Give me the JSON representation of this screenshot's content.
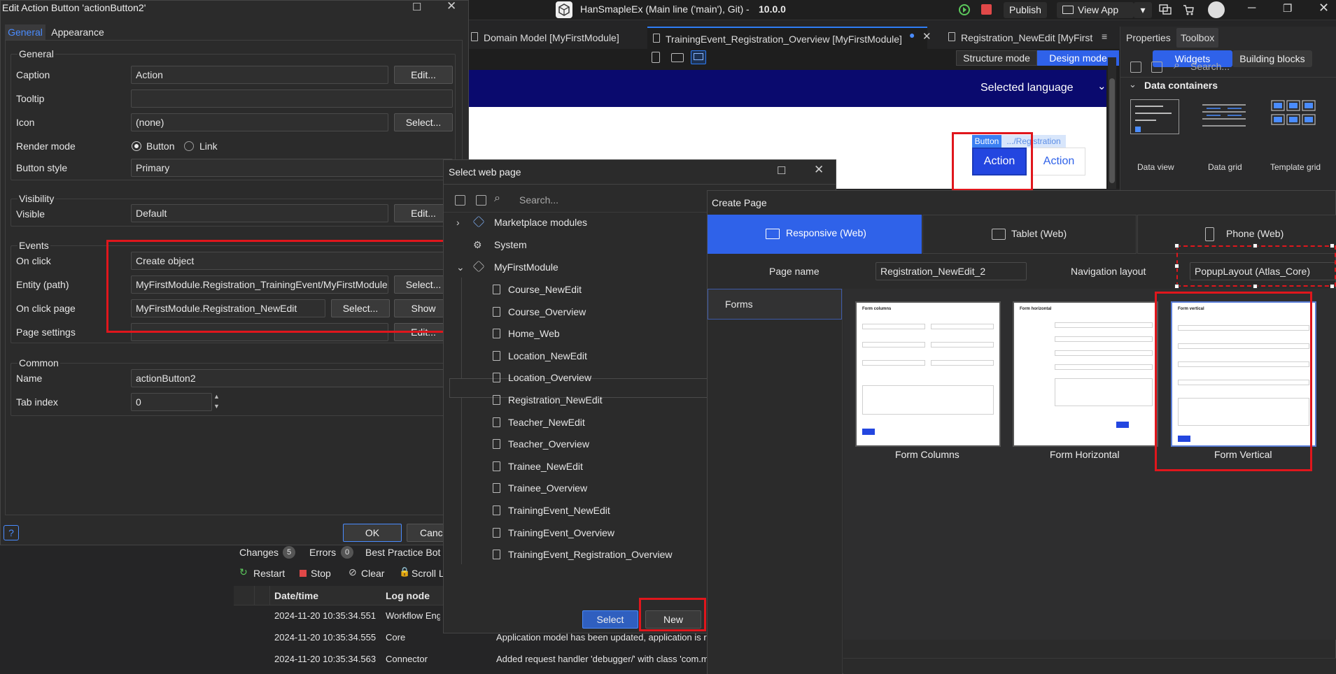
{
  "app": {
    "title": "HanSmapleEx (Main line ('main'), Git)",
    "separator": "-",
    "version": "10.0.0",
    "publish_label": "Publish",
    "view_app_label": "View App"
  },
  "doc_tabs": [
    {
      "label": "Domain Model [MyFirstModule]"
    },
    {
      "label": "TrainingEvent_Registration_Overview [MyFirstModule]"
    },
    {
      "label": "Registration_NewEdit [MyFirst"
    }
  ],
  "canvas": {
    "mode_structure": "Structure mode",
    "mode_design": "Design mode",
    "selected_language": "Selected language",
    "tag_button": "Button",
    "tag_path": ".../Registration",
    "action_primary": "Action",
    "action_secondary": "Action"
  },
  "right_panel": {
    "tab_properties": "Properties",
    "tab_toolbox": "Toolbox",
    "seg_widgets": "Widgets",
    "seg_building_blocks": "Building blocks",
    "search_placeholder": "Search...",
    "section": "Data containers",
    "widgets": [
      "Data view",
      "Data grid",
      "Template grid"
    ]
  },
  "edit_dialog": {
    "title": "Edit Action Button 'actionButton2'",
    "tab_general": "General",
    "tab_appearance": "Appearance",
    "group_general": "General",
    "caption_label": "Caption",
    "caption_value": "Action",
    "edit_label": "Edit...",
    "tooltip_label": "Tooltip",
    "tooltip_value": "",
    "icon_label": "Icon",
    "icon_value": "(none)",
    "select_label": "Select...",
    "render_mode_label": "Render mode",
    "render_button": "Button",
    "render_link": "Link",
    "button_style_label": "Button style",
    "button_style_value": "Primary",
    "group_visibility": "Visibility",
    "visible_label": "Visible",
    "visible_value": "Default",
    "group_events": "Events",
    "on_click_label": "On click",
    "on_click_value": "Create object",
    "entity_label": "Entity (path)",
    "entity_value": "MyFirstModule.Registration_TrainingEvent/MyFirstModule.I",
    "on_click_page_label": "On click page",
    "on_click_page_value": "MyFirstModule.Registration_NewEdit",
    "show_label": "Show",
    "page_settings_label": "Page settings",
    "group_common": "Common",
    "name_label": "Name",
    "name_value": "actionButton2",
    "tab_index_label": "Tab index",
    "tab_index_value": "0",
    "ok_label": "OK",
    "cancel_label": "Cance"
  },
  "select_dialog": {
    "title": "Select web page",
    "search_placeholder": "Search...",
    "tree": [
      {
        "label": "Marketplace modules"
      },
      {
        "label": "System"
      },
      {
        "label": "MyFirstModule"
      }
    ],
    "pages": [
      "Course_NewEdit",
      "Course_Overview",
      "Home_Web",
      "Location_NewEdit",
      "Location_Overview",
      "Registration_NewEdit",
      "Teacher_NewEdit",
      "Teacher_Overview",
      "Trainee_NewEdit",
      "Trainee_Overview",
      "TrainingEvent_NewEdit",
      "TrainingEvent_Overview",
      "TrainingEvent_Registration_Overview"
    ],
    "select_label": "Select",
    "new_label": "New"
  },
  "create_page": {
    "title": "Create Page",
    "tab_responsive": "Responsive (Web)",
    "tab_tablet": "Tablet (Web)",
    "tab_phone": "Phone (Web)",
    "page_name_label": "Page name",
    "page_name_value": "Registration_NewEdit_2",
    "nav_layout_label": "Navigation layout",
    "nav_layout_value": "PopupLayout (Atlas_Core)",
    "category": "Forms",
    "templates": [
      {
        "name": "Form Columns",
        "heading": "Form columns"
      },
      {
        "name": "Form Horizontal",
        "heading": "Form horizontal"
      },
      {
        "name": "Form Vertical",
        "heading": "Form vertical"
      }
    ]
  },
  "bottom": {
    "changes_label": "Changes",
    "changes_count": "5",
    "errors_label": "Errors",
    "errors_count": "0",
    "best_practice_label": "Best Practice Bot",
    "restart_label": "Restart",
    "stop_label": "Stop",
    "clear_label": "Clear",
    "scroll_label": "Scroll L",
    "col_datetime": "Date/time",
    "col_lognode": "Log node",
    "rows": [
      {
        "time": "2024-11-20 10:35:34.551",
        "node": "Workflow Engi",
        "msg": ""
      },
      {
        "time": "2024-11-20 10:35:34.555",
        "node": "Core",
        "msg": "Application model has been updated, application is r"
      },
      {
        "time": "2024-11-20 10:35:34.563",
        "node": "Connector",
        "msg": "Added request handler 'debugger/' with class 'com.m"
      }
    ]
  },
  "colors": {
    "accent": "#2f62e9",
    "highlight": "#e0161c",
    "nav_bar": "#0a0a6e"
  }
}
